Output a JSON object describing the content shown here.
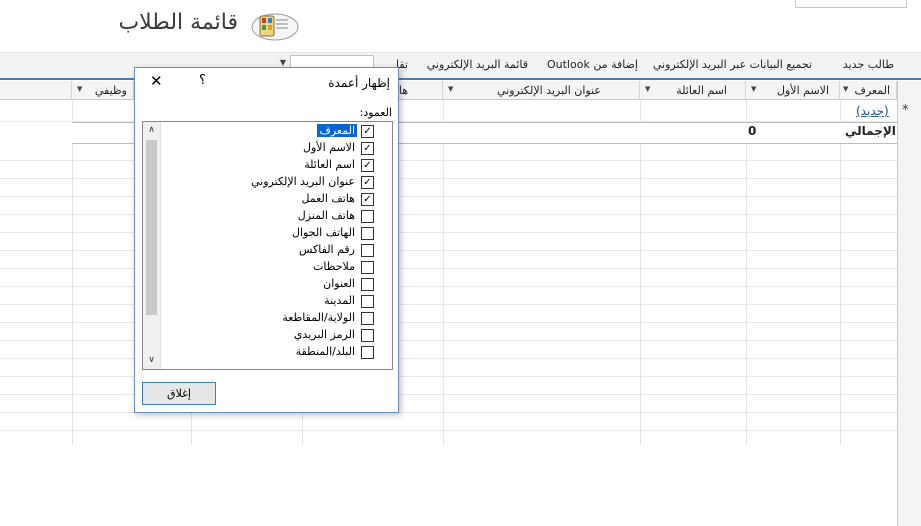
{
  "header": {
    "title": "قائمة الطلاب",
    "icon": "student-list-app-icon"
  },
  "toolbar": {
    "items": [
      {
        "id": "new_student",
        "label": "طالب جديد"
      },
      {
        "id": "collect_email",
        "label": "تجميع البيانات عبر البريد الإلكتروني"
      },
      {
        "id": "add_outlook",
        "label": "إضافة من Outlook"
      },
      {
        "id": "email_list",
        "label": "قائمة البريد الإلكتروني"
      },
      {
        "id": "reports",
        "label": "تقا"
      }
    ],
    "combo_value": ""
  },
  "datasheet": {
    "columns": [
      {
        "label": "المعرف",
        "has_arrow": true
      },
      {
        "label": "الاسم الأول",
        "has_arrow": true
      },
      {
        "label": "اسم العائلة",
        "has_arrow": true
      },
      {
        "label": "عنوان البريد الإلكتروني",
        "has_arrow": true
      },
      {
        "label": "ها",
        "has_arrow": false
      },
      {
        "label": "وظيفي",
        "has_arrow": true
      }
    ],
    "new_row_text": "(جديد)",
    "new_row_marker": "*",
    "total_label": "الإجمالي",
    "total_count": "0"
  },
  "dialog": {
    "title": "إظهار أعمدة",
    "help": "؟",
    "close": "✕",
    "list_label": "العمود:",
    "items": [
      {
        "label": "المعرف",
        "checked": true,
        "selected": true
      },
      {
        "label": "الاسم الأول",
        "checked": true,
        "selected": false
      },
      {
        "label": "اسم العائلة",
        "checked": true,
        "selected": false
      },
      {
        "label": "عنوان البريد الإلكتروني",
        "checked": true,
        "selected": false
      },
      {
        "label": "هاتف العمل",
        "checked": true,
        "selected": false
      },
      {
        "label": "هاتف المنزل",
        "checked": false,
        "selected": false
      },
      {
        "label": "الهاتف الجوال",
        "checked": false,
        "selected": false
      },
      {
        "label": "رقم الفاكس",
        "checked": false,
        "selected": false
      },
      {
        "label": "ملاحظات",
        "checked": false,
        "selected": false
      },
      {
        "label": "العنوان",
        "checked": false,
        "selected": false
      },
      {
        "label": "المدينة",
        "checked": false,
        "selected": false
      },
      {
        "label": "الولاية/المقاطعة",
        "checked": false,
        "selected": false
      },
      {
        "label": "الرمز البريدي",
        "checked": false,
        "selected": false
      },
      {
        "label": "البلد/المنطقة",
        "checked": false,
        "selected": false
      }
    ],
    "close_button": "إغلاق"
  },
  "colors": {
    "accent": "#4a7ebb",
    "selection": "#0a64d2",
    "link": "#1f4e9a"
  }
}
